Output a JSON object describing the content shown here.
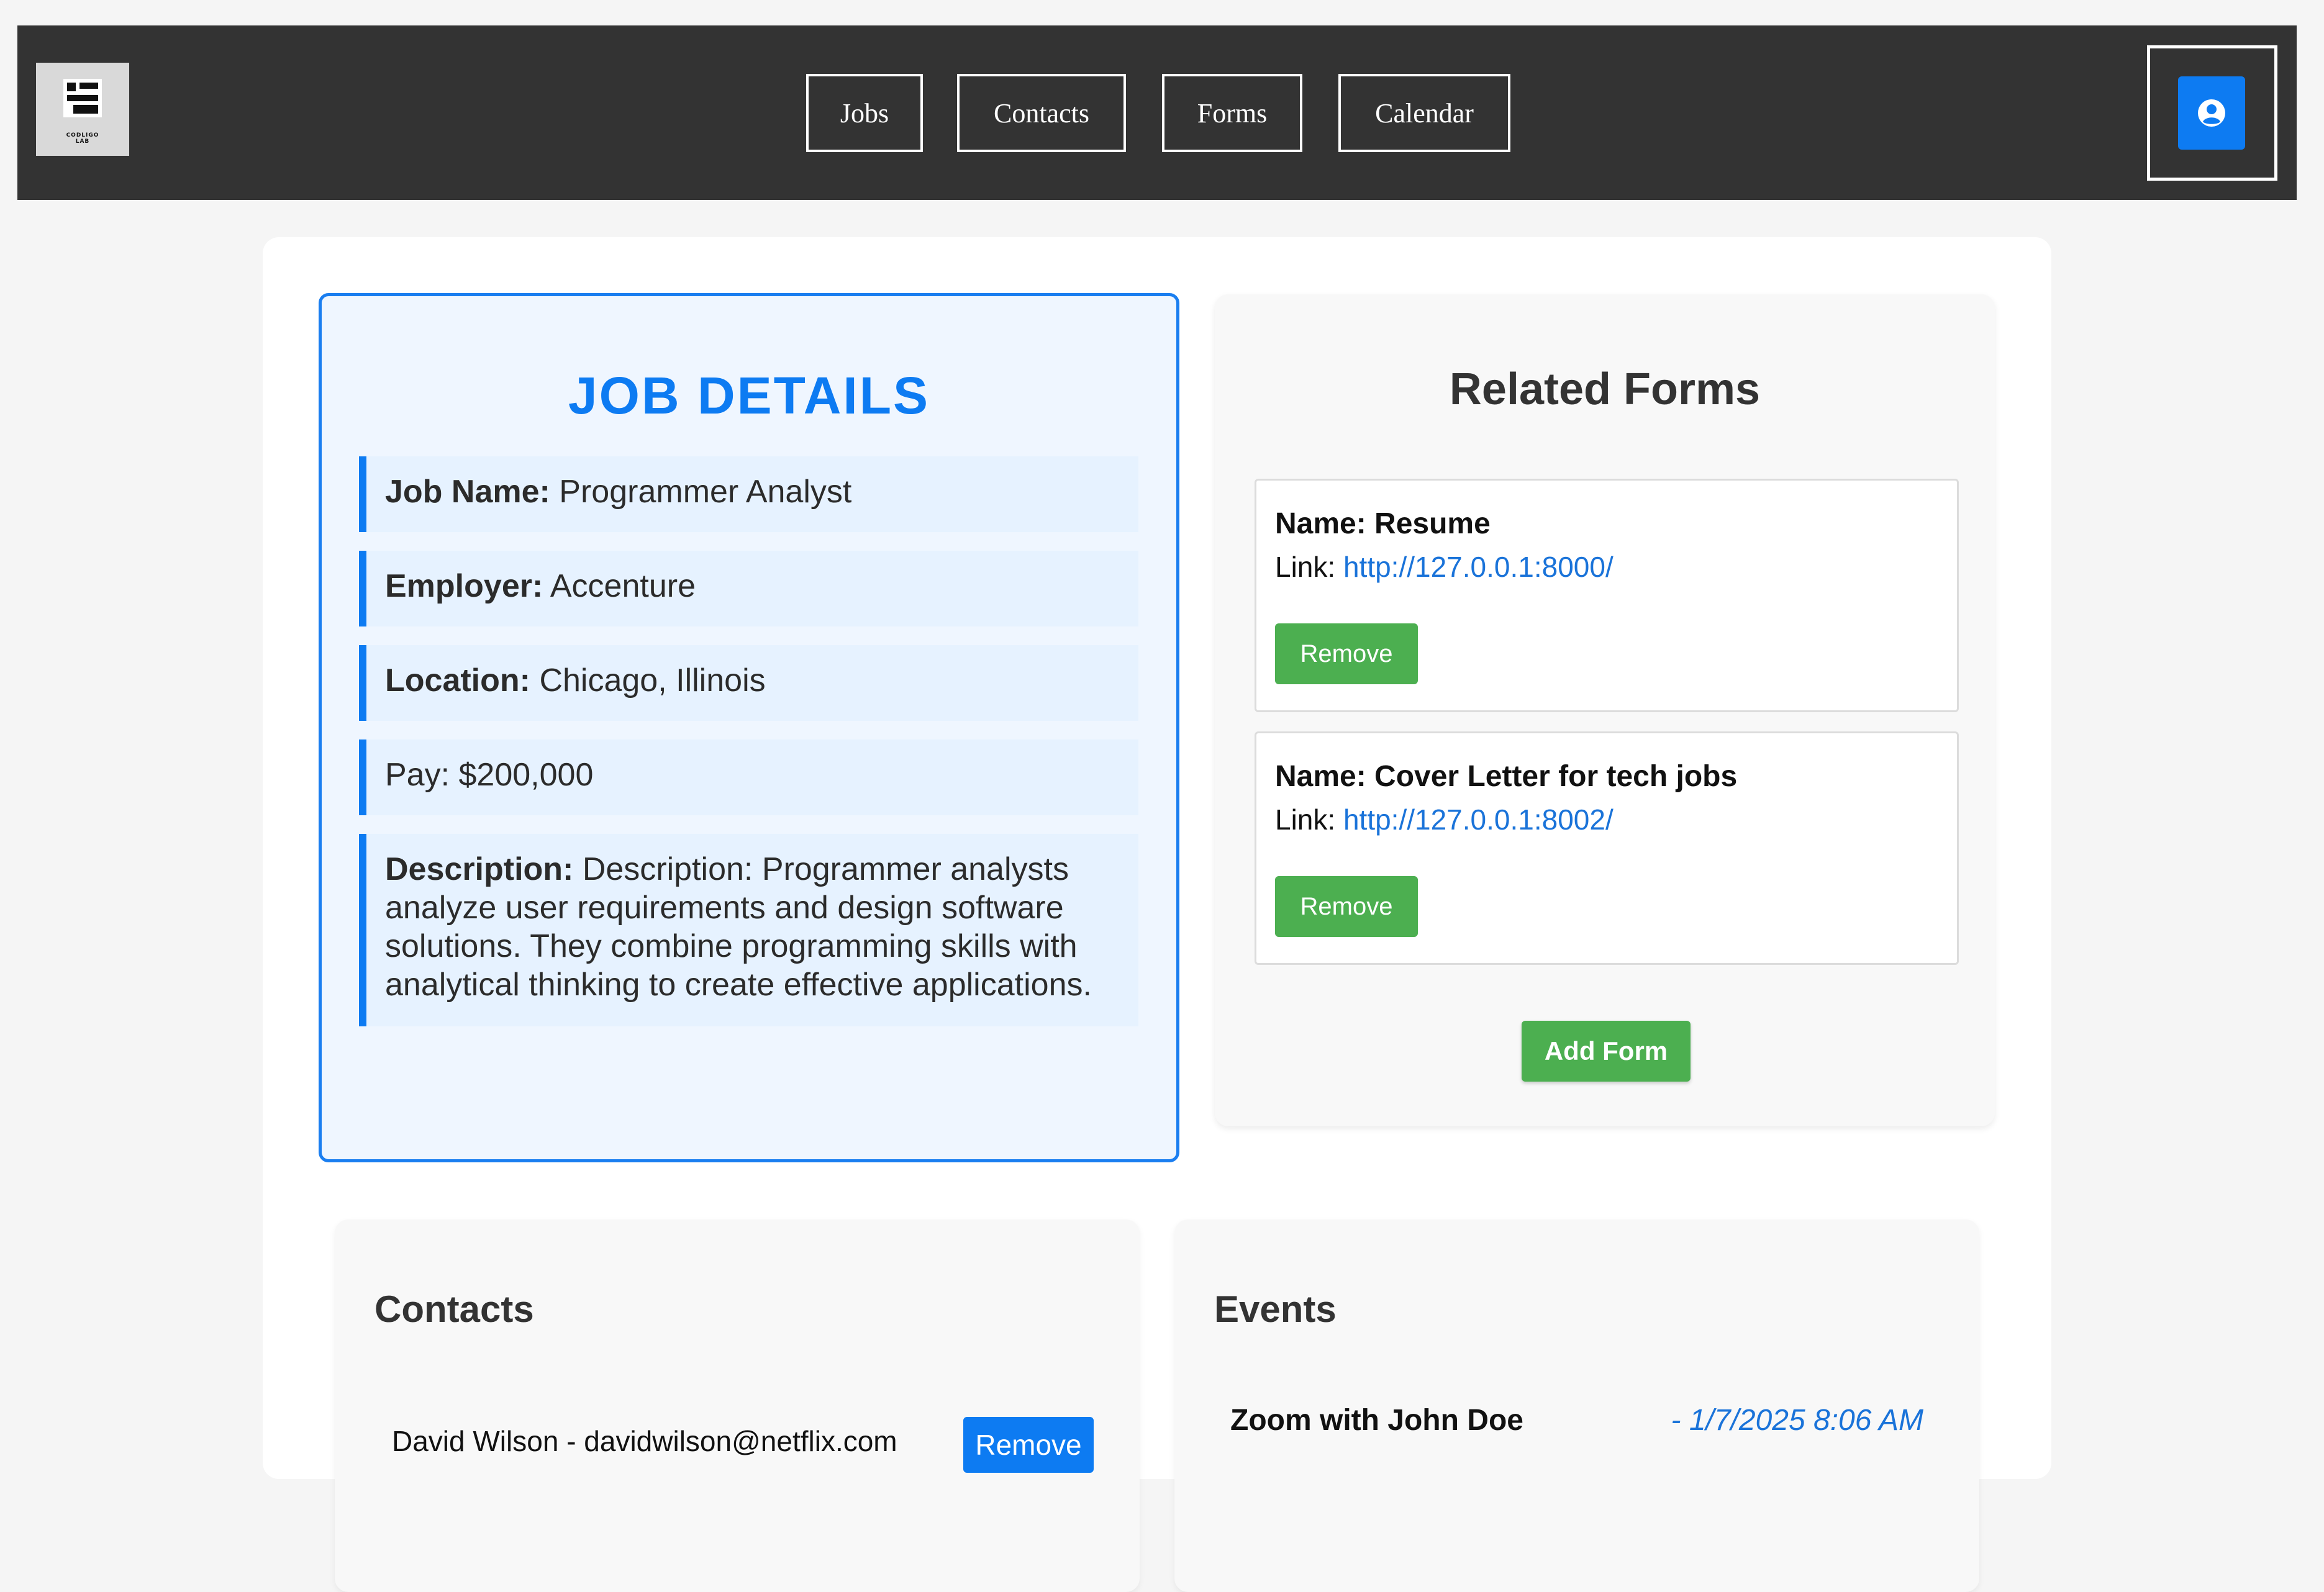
{
  "header": {
    "logo_text": "CODLIGO\nLAB"
  },
  "nav": {
    "items": [
      {
        "label": "Jobs"
      },
      {
        "label": "Contacts"
      },
      {
        "label": "Forms"
      },
      {
        "label": "Calendar"
      }
    ]
  },
  "profile": {
    "icon": "user-circle-icon"
  },
  "job": {
    "title": "JOB DETAILS",
    "name_label": "Job Name:",
    "name_value": "Programmer Analyst",
    "employer_label": "Employer:",
    "employer_value": "Accenture",
    "location_label": "Location:",
    "location_value": "Chicago, Illinois",
    "pay_text": "Pay: $200,000",
    "description_label": "Description:",
    "description_value": "Description: Programmer analysts analyze user requirements and design software solutions. They combine programming skills with analytical thinking to create effective applications."
  },
  "forms": {
    "title": "Related Forms",
    "items": [
      {
        "name": "Name: Resume",
        "link_label": "Link: ",
        "url": "http://127.0.0.1:8000/",
        "remove_label": "Remove"
      },
      {
        "name": "Name: Cover Letter for tech jobs",
        "link_label": "Link: ",
        "url": "http://127.0.0.1:8002/",
        "remove_label": "Remove"
      }
    ],
    "add_label": "Add Form"
  },
  "contacts": {
    "title": "Contacts",
    "items": [
      {
        "text": "David Wilson - davidwilson@netflix.com",
        "remove_label": "Remove"
      }
    ]
  },
  "events": {
    "title": "Events",
    "items": [
      {
        "name": "Zoom with John Doe",
        "date": "- 1/7/2025 8:06 AM"
      }
    ]
  },
  "colors": {
    "header_bg": "#333333",
    "accent_blue": "#0d7bf2",
    "green": "#4caf50",
    "link_blue": "#1a73d9"
  }
}
